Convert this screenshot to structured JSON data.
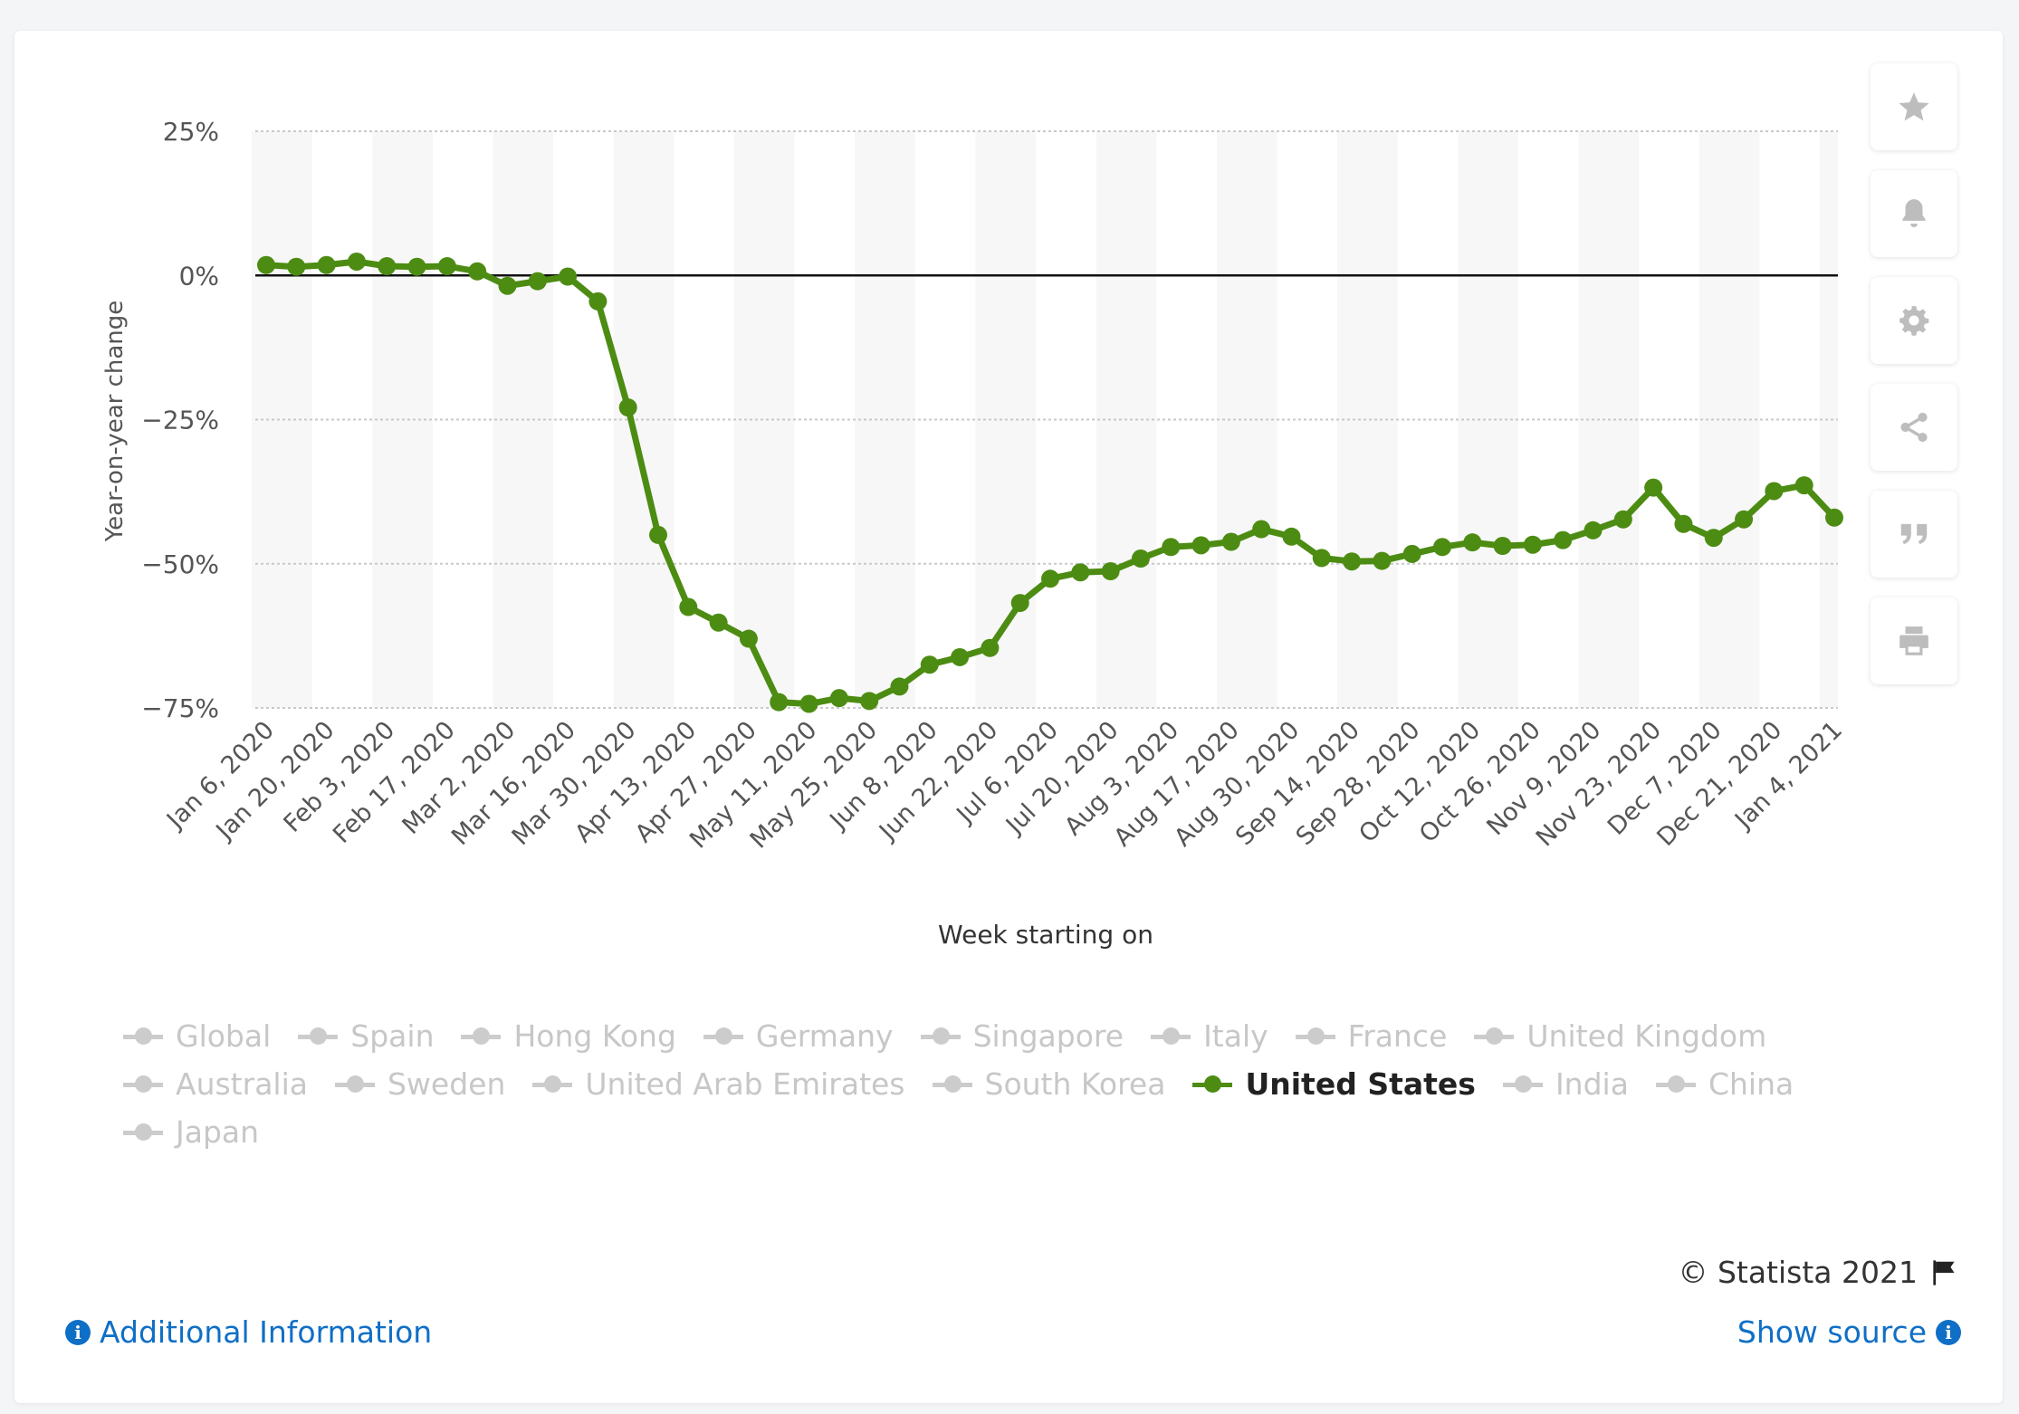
{
  "chart_data": {
    "type": "line",
    "title": "",
    "xlabel": "Week starting on",
    "ylabel": "Year-on-year change",
    "ylim": [
      -75,
      25
    ],
    "y_ticks": [
      25,
      0,
      -25,
      -50,
      -75
    ],
    "y_tick_labels": [
      "25%",
      "0%",
      "−25%",
      "−50%",
      "−75%"
    ],
    "x_tick_labels": [
      "Jan 6, 2020",
      "Jan 20, 2020",
      "Feb 3, 2020",
      "Feb 17, 2020",
      "Mar 2, 2020",
      "Mar 16, 2020",
      "Mar 30, 2020",
      "Apr 13, 2020",
      "Apr 27, 2020",
      "May 11, 2020",
      "May 25, 2020",
      "Jun 8, 2020",
      "Jun 22, 2020",
      "Jul 6, 2020",
      "Jul 20, 2020",
      "Aug 3, 2020",
      "Aug 17, 2020",
      "Aug 30, 2020",
      "Sep 14, 2020",
      "Sep 28, 2020",
      "Oct 12, 2020",
      "Oct 26, 2020",
      "Nov 9, 2020",
      "Nov 23, 2020",
      "Dec 7, 2020",
      "Dec 21, 2020",
      "Jan 4, 2021"
    ],
    "x": [
      "Jan 6, 2020",
      "Jan 13, 2020",
      "Jan 20, 2020",
      "Jan 27, 2020",
      "Feb 3, 2020",
      "Feb 10, 2020",
      "Feb 17, 2020",
      "Feb 24, 2020",
      "Mar 2, 2020",
      "Mar 9, 2020",
      "Mar 16, 2020",
      "Mar 23, 2020",
      "Mar 30, 2020",
      "Apr 6, 2020",
      "Apr 13, 2020",
      "Apr 20, 2020",
      "Apr 27, 2020",
      "May 4, 2020",
      "May 11, 2020",
      "May 18, 2020",
      "May 25, 2020",
      "Jun 1, 2020",
      "Jun 8, 2020",
      "Jun 15, 2020",
      "Jun 22, 2020",
      "Jun 29, 2020",
      "Jul 6, 2020",
      "Jul 13, 2020",
      "Jul 20, 2020",
      "Jul 27, 2020",
      "Aug 3, 2020",
      "Aug 10, 2020",
      "Aug 17, 2020",
      "Aug 24, 2020",
      "Aug 30, 2020",
      "Sep 7, 2020",
      "Sep 14, 2020",
      "Sep 21, 2020",
      "Sep 28, 2020",
      "Oct 5, 2020",
      "Oct 12, 2020",
      "Oct 19, 2020",
      "Oct 26, 2020",
      "Nov 2, 2020",
      "Nov 9, 2020",
      "Nov 16, 2020",
      "Nov 23, 2020",
      "Nov 30, 2020",
      "Dec 7, 2020",
      "Dec 14, 2020",
      "Dec 21, 2020",
      "Dec 28, 2020",
      "Jan 4, 2021"
    ],
    "series": [
      {
        "name": "United States",
        "color": "#4d8c13",
        "values": [
          1.8,
          1.5,
          1.8,
          2.4,
          1.6,
          1.5,
          1.6,
          0.7,
          -1.8,
          -1.0,
          -0.2,
          -4.5,
          -22.9,
          -45.0,
          -57.5,
          -60.2,
          -63.0,
          -74.0,
          -74.3,
          -73.3,
          -73.8,
          -71.3,
          -67.5,
          -66.2,
          -64.6,
          -56.8,
          -52.6,
          -51.5,
          -51.3,
          -49.1,
          -47.1,
          -46.8,
          -46.2,
          -44.0,
          -45.3,
          -49.0,
          -49.6,
          -49.5,
          -48.3,
          -47.1,
          -46.3,
          -46.9,
          -46.7,
          -45.9,
          -44.2,
          -42.3,
          -36.8,
          -43.1,
          -45.5,
          -42.3,
          -37.4,
          -36.4,
          -42.0
        ]
      }
    ],
    "grid": true,
    "legend_position": "bottom"
  },
  "legend": {
    "rows": [
      [
        {
          "label": "Global"
        },
        {
          "label": "Spain"
        },
        {
          "label": "Hong Kong"
        },
        {
          "label": "Germany"
        },
        {
          "label": "Singapore"
        },
        {
          "label": "Italy"
        },
        {
          "label": "France"
        },
        {
          "label": "United Kingdom"
        }
      ],
      [
        {
          "label": "Australia"
        },
        {
          "label": "Sweden"
        },
        {
          "label": "United Arab Emirates"
        },
        {
          "label": "South Korea"
        },
        {
          "label": "United States",
          "active": true
        },
        {
          "label": "India"
        },
        {
          "label": "China"
        }
      ],
      [
        {
          "label": "Japan"
        }
      ]
    ]
  },
  "toolbar": [
    "star-icon",
    "bell-icon",
    "gear-icon",
    "share-icon",
    "quote-icon",
    "print-icon"
  ],
  "footer": {
    "copyright": "© Statista 2021",
    "additional_info": "Additional Information",
    "show_source": "Show source"
  },
  "colors": {
    "series": "#4d8c13",
    "inactive": "#cccccc",
    "link": "#0f6fc6"
  }
}
